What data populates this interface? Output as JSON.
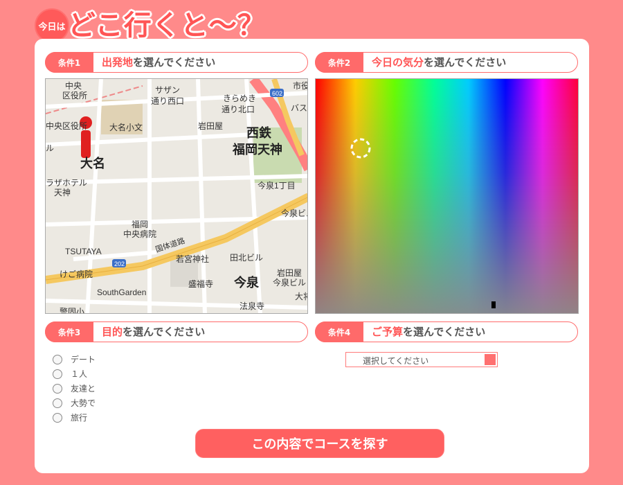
{
  "header": {
    "badge": "今日は",
    "title": "どこ行くと〜？"
  },
  "conditions": [
    {
      "tag": "条件1",
      "highlight": "出発地",
      "rest": "を選んでください"
    },
    {
      "tag": "条件2",
      "highlight": "今日の気分",
      "rest": "を選んでください"
    },
    {
      "tag": "条件3",
      "highlight": "目的",
      "rest": "を選んでください"
    },
    {
      "tag": "条件4",
      "highlight": "ご予算",
      "rest": "を選んでください"
    }
  ],
  "map": {
    "labels": {
      "l1": "中央",
      "l2": "区役所",
      "l3": "サザン",
      "l4": "通り西口",
      "l5": "きらめき",
      "l6": "通り北口",
      "l7": "市役",
      "l8": "バス",
      "l9": "中央区役所",
      "l10": "大名小文",
      "l11": "岩田屋",
      "l12": "西鉄",
      "l13": "福岡天神",
      "l14": "ル",
      "l15": "大名",
      "l16": "ラザホテル",
      "l17": "天神",
      "l18": "今泉1丁目",
      "l19": "今泉ビル",
      "l20": "福岡",
      "l21": "中央病院",
      "l22": "国体道路",
      "l23": "TSUTAYA",
      "l24": "若宮神社",
      "l25": "田北ビル",
      "l26": "岩田屋",
      "l27": "今泉ビル",
      "l28": "けご病院",
      "l29": "盛福寺",
      "l30": "今泉",
      "l31": "SouthGarden",
      "l32": "法泉寺",
      "l33": "大将",
      "l34": "警固小",
      "l35": "602",
      "l36": "202"
    }
  },
  "purpose_options": [
    "デート",
    "１人",
    "友達と",
    "大勢で",
    "旅行"
  ],
  "budget": {
    "selected": "選択してください"
  },
  "submit_label": "この内容でコースを探す",
  "colors": {
    "accent": "#ff6060",
    "background": "#ff8a8a"
  }
}
